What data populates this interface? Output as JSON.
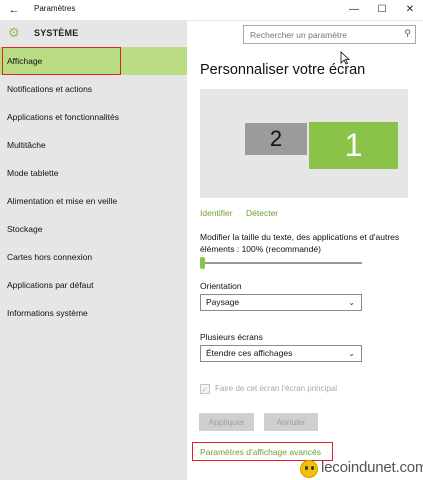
{
  "window": {
    "title": "Paramètres",
    "back_icon": "←",
    "minimize_icon": "—",
    "maximize_icon": "☐",
    "close_icon": "✕"
  },
  "sidebar": {
    "header_icon": "gear-icon",
    "header_label": "SYSTÈME",
    "items": [
      {
        "label": "Affichage",
        "active": true
      },
      {
        "label": "Notifications et actions"
      },
      {
        "label": "Applications et fonctionnalités"
      },
      {
        "label": "Multitâche"
      },
      {
        "label": "Mode tablette"
      },
      {
        "label": "Alimentation et mise en veille"
      },
      {
        "label": "Stockage"
      },
      {
        "label": "Cartes hors connexion"
      },
      {
        "label": "Applications par défaut"
      },
      {
        "label": "Informations système"
      }
    ]
  },
  "search": {
    "placeholder": "Rechercher un paramètre",
    "icon": "search-icon"
  },
  "main": {
    "title": "Personnaliser votre écran",
    "monitors": {
      "primary": "1",
      "secondary": "2"
    },
    "identify_link": "Identifier",
    "detect_link": "Détecter",
    "size_label": "Modifier la taille du texte, des applications et d'autres éléments : 100% (recommandé)",
    "size_slider_fraction": 0.0,
    "orientation_label": "Orientation",
    "orientation_value": "Paysage",
    "multi_screens_label": "Plusieurs écrans",
    "multi_screens_value": "Étendre ces affichages",
    "primary_checkbox_label": "Faire de cet écran l'écran principal",
    "primary_checkbox_checked": true,
    "apply_button": "Appliquer",
    "cancel_button": "Annuler",
    "advanced_link": "Paramètres d'affichage avancés"
  },
  "watermark": {
    "text": "lecoindunet.com"
  },
  "colors": {
    "accent": "#8bc34a",
    "link": "#6da133",
    "sidebar_bg": "#e6e6e6",
    "highlight_frame": "#dd2222"
  }
}
